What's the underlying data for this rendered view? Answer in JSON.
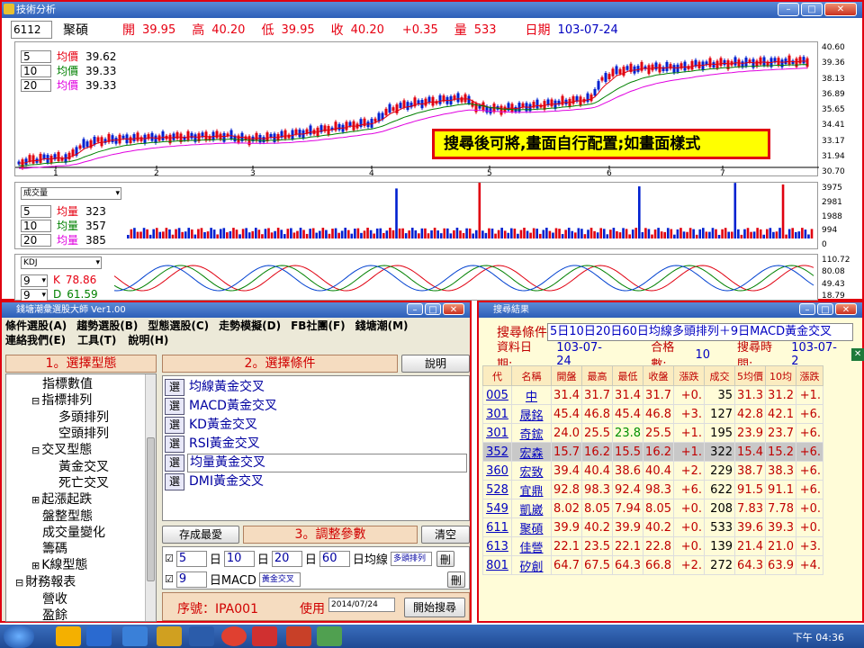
{
  "chart_window": {
    "title": "技術分析",
    "quote": {
      "code": "6112",
      "name": "聚碩",
      "open_label": "開",
      "open": "39.95",
      "high_label": "高",
      "high": "40.20",
      "low_label": "低",
      "low": "39.95",
      "close_label": "收",
      "close": "40.20",
      "change": "+0.35",
      "vol_label": "量",
      "volume": "533",
      "date_label": "日期",
      "date": "103-07-24"
    },
    "price_ma": [
      {
        "period": "5",
        "label": "均價",
        "value": "39.62",
        "color": "#e60012"
      },
      {
        "period": "10",
        "label": "均價",
        "value": "39.33",
        "color": "#008000"
      },
      {
        "period": "20",
        "label": "均價",
        "value": "39.33",
        "color": "#e000e0"
      }
    ],
    "price_axis": [
      "40.60",
      "39.36",
      "38.13",
      "36.89",
      "35.65",
      "34.41",
      "33.17",
      "31.94",
      "30.70"
    ],
    "x_ticks": [
      "1",
      "2",
      "3",
      "4",
      "5",
      "6",
      "7"
    ],
    "note": "搜尋後可將,畫面自行配置;如畫面樣式",
    "volume_panel": {
      "selector": "成交量",
      "ma": [
        {
          "period": "5",
          "label": "均量",
          "value": "323",
          "color": "#e60012"
        },
        {
          "period": "10",
          "label": "均量",
          "value": "357",
          "color": "#008000"
        },
        {
          "period": "20",
          "label": "均量",
          "value": "385",
          "color": "#e000e0"
        }
      ],
      "axis": [
        "3975",
        "2981",
        "1988",
        "994",
        "0"
      ]
    },
    "kdj_panel": {
      "selector": "KDJ",
      "k": {
        "period": "9",
        "label": "K",
        "value": "78.86"
      },
      "d": {
        "period": "9",
        "label": "D",
        "value": "61.59"
      },
      "axis": [
        "110.72",
        "80.08",
        "49.43",
        "18.79"
      ]
    }
  },
  "left_window": {
    "title": "錢塘潮彙選股大師 Ver1.00",
    "menu_row1": [
      "條件選股(A)",
      "趨勢選股(B)",
      "型態選股(C)",
      "走勢模擬(D)",
      "FB社團(F)",
      "錢塘潮(M)"
    ],
    "menu_row2": [
      "連絡我們(E)",
      "工具(T)",
      "說明(H)"
    ],
    "section1": "1。選擇型態",
    "tree": [
      {
        "text": "指標數值",
        "indent": 1,
        "prefix": ""
      },
      {
        "text": "指標排列",
        "indent": 1,
        "prefix": "⊟"
      },
      {
        "text": "多頭排列",
        "indent": 2,
        "prefix": ""
      },
      {
        "text": "空頭排列",
        "indent": 2,
        "prefix": ""
      },
      {
        "text": "交叉型態",
        "indent": 1,
        "prefix": "⊟"
      },
      {
        "text": "黃金交叉",
        "indent": 2,
        "prefix": ""
      },
      {
        "text": "死亡交叉",
        "indent": 2,
        "prefix": ""
      },
      {
        "text": "起漲起跌",
        "indent": 1,
        "prefix": "⊞"
      },
      {
        "text": "盤整型態",
        "indent": 1,
        "prefix": ""
      },
      {
        "text": "成交量變化",
        "indent": 1,
        "prefix": ""
      },
      {
        "text": "籌碼",
        "indent": 1,
        "prefix": ""
      },
      {
        "text": "K線型態",
        "indent": 1,
        "prefix": "⊞"
      },
      {
        "text": "財務報表",
        "indent": 0,
        "prefix": "⊟"
      },
      {
        "text": "營收",
        "indent": 1,
        "prefix": ""
      },
      {
        "text": "盈餘",
        "indent": 1,
        "prefix": ""
      }
    ],
    "section2": "2。選擇條件",
    "help_button": "說明",
    "select_label": "選",
    "conditions": [
      "均線黃金交叉",
      "MACD黃金交叉",
      "KD黃金交叉",
      "RSI黃金交叉",
      "均量黃金交叉",
      "DMI黃金交叉"
    ],
    "save_button": "存成最愛",
    "section3": "3。調整參數",
    "clear_button": "清空",
    "param1": {
      "p1": "5",
      "u1": "日",
      "p2": "10",
      "u2": "日",
      "p3": "20",
      "u3": "日",
      "p4": "60",
      "suffix": "日均線",
      "mode": "多頭排列",
      "delete": "刪"
    },
    "param2": {
      "p1": "9",
      "suffix": "日MACD",
      "mode": "黃金交叉",
      "delete": "刪"
    },
    "serial_label": "序號：IPA001",
    "use_label": "使用",
    "date_value": "2014/07/24",
    "search_button": "開始搜尋"
  },
  "right_window": {
    "title": "搜尋結果",
    "condition_label": "搜尋條件",
    "condition_value": "5日10日20日60日均線多頭排列＋9日MACD黃金交叉",
    "data_date_label": "資料日期:",
    "data_date": "103-07-24",
    "match_label": "合格數:",
    "match_count": "10",
    "search_time_label": "搜尋時間:",
    "search_time": "103-07-2",
    "columns": [
      "代",
      "名稱",
      "開盤",
      "最高",
      "最低",
      "收盤",
      "漲跌",
      "成交",
      "5均價",
      "10均",
      "漲跌"
    ],
    "rows": [
      [
        "005",
        "中",
        "31.4",
        "31.7",
        "31.4",
        "31.7",
        "+0.",
        "35",
        "31.3",
        "31.2",
        "+1."
      ],
      [
        "301",
        "晟銘",
        "45.4",
        "46.8",
        "45.4",
        "46.8",
        "+3.",
        "127",
        "42.8",
        "42.1",
        "+6."
      ],
      [
        "301",
        "奇鋐",
        "24.0",
        "25.5",
        "23.8",
        "25.5",
        "+1.",
        "195",
        "23.9",
        "23.7",
        "+6."
      ],
      [
        "352",
        "宏森",
        "15.7",
        "16.2",
        "15.5",
        "16.2",
        "+1.",
        "322",
        "15.4",
        "15.2",
        "+6."
      ],
      [
        "360",
        "宏致",
        "39.4",
        "40.4",
        "38.6",
        "40.4",
        "+2.",
        "229",
        "38.7",
        "38.3",
        "+6."
      ],
      [
        "528",
        "宜鼎",
        "92.8",
        "98.3",
        "92.4",
        "98.3",
        "+6.",
        "622",
        "91.5",
        "91.1",
        "+6."
      ],
      [
        "549",
        "凱崴",
        "8.02",
        "8.05",
        "7.94",
        "8.05",
        "+0.",
        "208",
        "7.83",
        "7.78",
        "+0."
      ],
      [
        "611",
        "聚碩",
        "39.9",
        "40.2",
        "39.9",
        "40.2",
        "+0.",
        "533",
        "39.6",
        "39.3",
        "+0."
      ],
      [
        "613",
        "佳營",
        "22.1",
        "23.5",
        "22.1",
        "22.8",
        "+0.",
        "139",
        "21.4",
        "21.0",
        "+3."
      ],
      [
        "801",
        "矽創",
        "64.7",
        "67.5",
        "64.3",
        "66.8",
        "+2.",
        "272",
        "64.3",
        "63.9",
        "+4."
      ]
    ]
  },
  "taskbar": {
    "clock": "下午 04:36"
  }
}
